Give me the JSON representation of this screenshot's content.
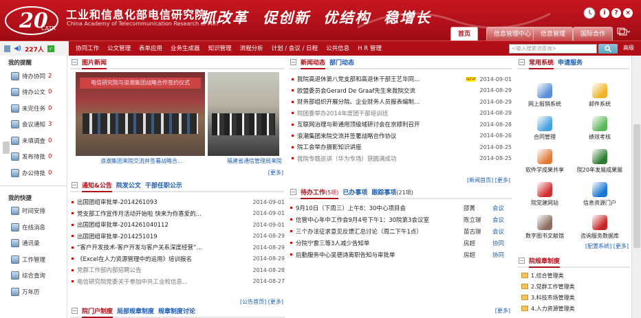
{
  "header": {
    "org_cn": "工业和信息化部电信研究院",
    "org_en": "China Academy of Telecommunication Research of MIIT",
    "slogan": [
      "抓改革",
      "促创新",
      "优结构",
      "稳增长"
    ],
    "tabs": [
      "首页",
      "信息管理中心",
      "信息管理",
      "国际合作"
    ],
    "active_tab": "首页",
    "accent": "#b10f18"
  },
  "status": {
    "online": "227人"
  },
  "menu": [
    "协同工作",
    "公文管理",
    "表单应用",
    "业务生成器",
    "知识管理",
    "流程分析",
    "计划 / 会议 / 日程",
    "公共信息",
    "H R 管理"
  ],
  "search": {
    "placeholder": "<输入搜索词查询>",
    "adv": "高级"
  },
  "sidebar": {
    "reminder_title": "我的提醒",
    "reminders": [
      {
        "label": "待办协同",
        "count": "2"
      },
      {
        "label": "待办公文",
        "count": "0"
      },
      {
        "label": "未完任务",
        "count": "0"
      },
      {
        "label": "会议通知",
        "count": "3"
      },
      {
        "label": "未填调查",
        "count": "0"
      },
      {
        "label": "发布待批",
        "count": "0"
      },
      {
        "label": "办公待批",
        "count": "0"
      }
    ],
    "shortcut_title": "我的快捷",
    "shortcuts": [
      "时间安排",
      "在线消息",
      "通讯录",
      "工作管理",
      "综合查询",
      "万年历"
    ]
  },
  "pics": {
    "title": "图片新闻",
    "captions": [
      "浪潮集团来院交流并签署战略合...",
      "福建省通信管理局来院"
    ],
    "banner_text": "电信研究院与浪潮集团战略合作签约仪式",
    "more": "[更多]"
  },
  "news": {
    "tab1": "新闻动态",
    "tab2": "部门动态",
    "items": [
      {
        "t": "我院高退休第八党支部和高退休干部王艺华同...",
        "d": "2014-09-01",
        "dim": false,
        "new": "NEW"
      },
      {
        "t": "欧盟委员会Gerard De Graaf先生来我院交流",
        "d": "2014-08-29",
        "dim": false,
        "new": ""
      },
      {
        "t": "财务部组织开展分院、企业财务人员报表编制...",
        "d": "2014-08-29",
        "dim": false,
        "new": ""
      },
      {
        "t": "院团委举办2014年度团干部培训班",
        "d": "2014-08-29",
        "dim": true,
        "new": ""
      },
      {
        "t": "互联网治理与新通用顶级域研讨会在京顺利召开",
        "d": "2014-08-28",
        "dim": false,
        "new": ""
      },
      {
        "t": "浪潮集团来院交流并签署战略合作协议",
        "d": "2014-08-26",
        "dim": false,
        "new": ""
      },
      {
        "t": "院工会举办摄影知识讲座",
        "d": "2014-08-25",
        "dim": false,
        "new": ""
      },
      {
        "t": "我院专题巡讲（华为专场）获圆满成功",
        "d": "2014-08-25",
        "dim": true,
        "new": ""
      }
    ],
    "more1": "[新闻首页]",
    "more2": "[更多]"
  },
  "notice": {
    "tab1": "通知&公告",
    "tab2": "院发公文",
    "tab3": "干部任职公示",
    "items": [
      {
        "t": "出国团组审批单-2014261093",
        "d": "2014-09-01",
        "dim": false
      },
      {
        "t": "党支部工作宣传月活动开始啦 快来为你喜爱的...",
        "d": "2014-09-01",
        "dim": false
      },
      {
        "t": "出国团组审批单-2014261040112",
        "d": "2014-09-01",
        "dim": false
      },
      {
        "t": "出国团组审批单-2014251019",
        "d": "2014-08-29",
        "dim": false
      },
      {
        "t": "“客户开发技术-客户开发与客户关系深度经营”...",
        "d": "2014-08-29",
        "dim": false
      },
      {
        "t": "《Excel在人力资源管理中的运用》培训报名",
        "d": "2014-08-29",
        "dim": false
      },
      {
        "t": "党群工作部内部招聘公告",
        "d": "2014-08-28",
        "dim": true
      },
      {
        "t": "电信研究院党委关于参加中共工业和信息...",
        "d": "2014-08-27",
        "dim": true
      }
    ],
    "more1": "[公告首页]",
    "more2": "[更多]"
  },
  "todo": {
    "tab1": "待办工作",
    "tab1_count": "(5项)",
    "tab2": "已办事项",
    "tab3": "跟踪事项",
    "tab3_count": "(21项)",
    "items": [
      {
        "t": "9月10日（下周三）上午8：30中心项目会",
        "who": "邵菁",
        "cat": "会议"
      },
      {
        "t": "信管中心年中工作会9月4号下午1：30院第3会议室",
        "who": "陈立璟",
        "cat": "会议"
      },
      {
        "t": "三个办法征求意见反馈汇总讨论（周二下午1点）",
        "who": "苗古璟",
        "cat": "会议"
      },
      {
        "t": "分院宁雷三等3人减少告知单",
        "who": "房超",
        "cat": "协同"
      },
      {
        "t": "后勤服务中心吴德诗离职告知与审批单",
        "who": "房超",
        "cat": "协同"
      }
    ],
    "more": "[更多]"
  },
  "bottom": {
    "tab1": "院门户制度",
    "tab2": "局部规章制度",
    "tab3": "规章制度讨论"
  },
  "systems": {
    "tab1": "常用系统",
    "tab2": "申请服务",
    "items": [
      {
        "l": "网上报销系统",
        "c": "#5b8fd8"
      },
      {
        "l": "邮件系统",
        "c": "#f0b429"
      },
      {
        "l": "合同管理",
        "c": "#4aa3df"
      },
      {
        "l": "绩效考核",
        "c": "#5cb85c"
      },
      {
        "l": "软件学成果共享",
        "c": "#e07b39"
      },
      {
        "l": "院20年发展成果展",
        "c": "#2e7d32"
      },
      {
        "l": "院党建网站",
        "c": "#d32f2f"
      },
      {
        "l": "信息资源门户",
        "c": "#1976d2"
      },
      {
        "l": "数字图书文献馆",
        "c": "#8d6e63"
      },
      {
        "l": "咨询服务数据库",
        "c": "#c62828"
      }
    ],
    "more1": "[配置系统]",
    "more2": "[更多]"
  },
  "rules": {
    "title": "院规章制度",
    "items": [
      "1.综合管理类",
      "2.党群工作管理类",
      "3.科技市场管理类",
      "4.人力资源管理类"
    ]
  }
}
